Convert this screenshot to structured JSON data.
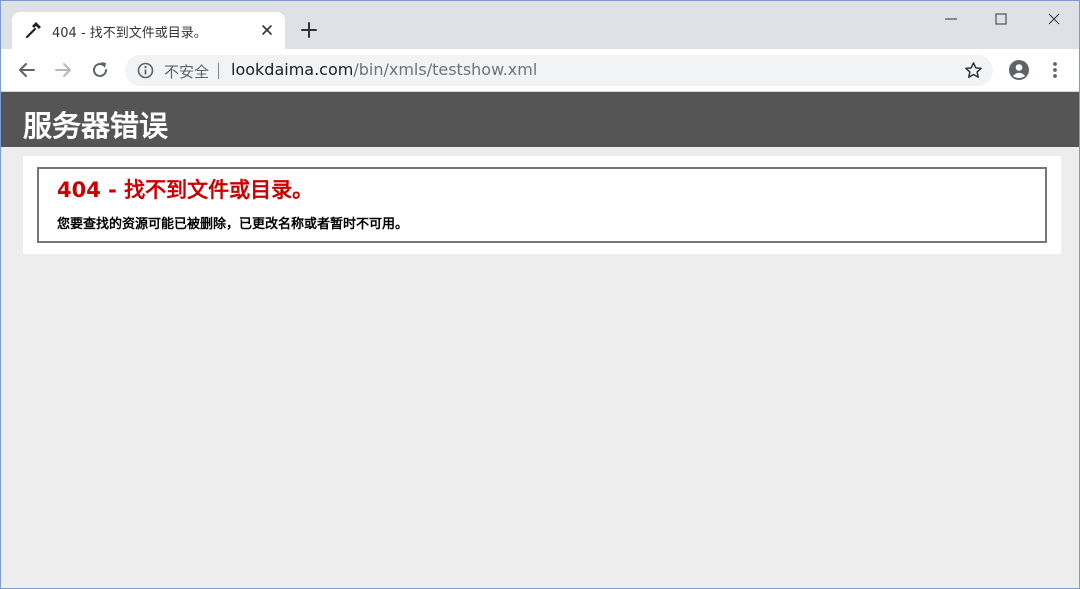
{
  "browser": {
    "tab": {
      "title": "404 - 找不到文件或目录。",
      "favicon": "hammer-icon"
    },
    "address_bar": {
      "security_label": "不安全",
      "url_domain": "lookdaima.com",
      "url_path": "/bin/xmls/testshow.xml"
    }
  },
  "page": {
    "header_title": "服务器错误",
    "error_title": "404 - 找不到文件或目录。",
    "error_description": "您要查找的资源可能已被删除，已更改名称或者暂时不可用。"
  },
  "colors": {
    "header_bg": "#555555",
    "error_title": "#cc0000",
    "page_bg": "#ededed"
  }
}
